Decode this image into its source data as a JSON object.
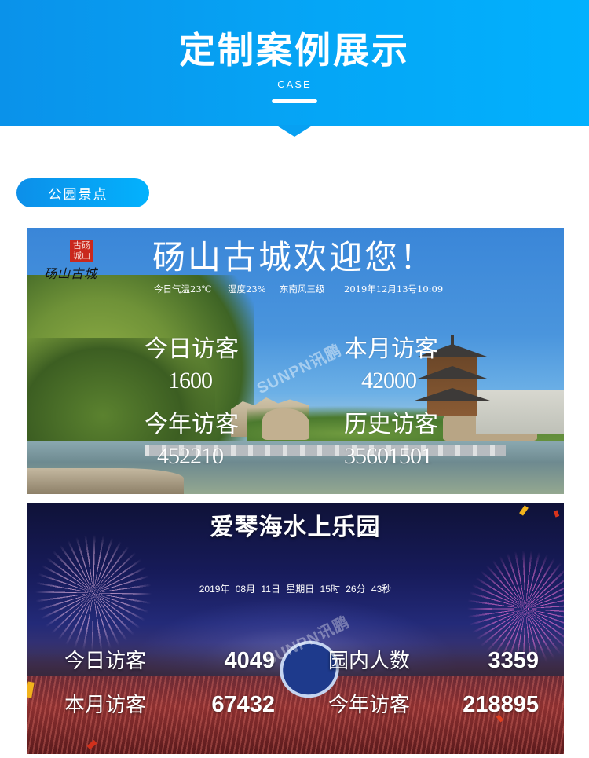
{
  "header": {
    "title": "定制案例展示",
    "subtitle": "CASE"
  },
  "category": {
    "label": "公园景点"
  },
  "screens": [
    {
      "name": "砀山古城",
      "seal_text": "古砀城山",
      "logo_text": "砀山古城",
      "title": "砀山古城欢迎您！",
      "info": {
        "temperature": "今日气温23℃",
        "humidity": "湿度23%",
        "wind": "东南风三级",
        "datetime": "2019年12月13号10:09"
      },
      "stats": [
        {
          "label": "今日访客",
          "value": "1600"
        },
        {
          "label": "本月访客",
          "value": "42000"
        },
        {
          "label": "今年访客",
          "value": "452210"
        },
        {
          "label": "历史访客",
          "value": "35601501"
        }
      ],
      "watermark": "SUNPN讯鹏"
    },
    {
      "name": "爱琴海水上乐园",
      "title": "爱琴海水上乐园",
      "datetime": "2019年 08月 11日 星期日 15时 26分 43秒",
      "stats": [
        {
          "label": "今日访客",
          "value": "4049"
        },
        {
          "label": "园内人数",
          "value": "3359"
        },
        {
          "label": "本月访客",
          "value": "67432"
        },
        {
          "label": "今年访客",
          "value": "218895"
        }
      ],
      "watermark": "SUNPN讯鹏"
    }
  ],
  "colors": {
    "brand_blue": "#07a0f2",
    "seal_red": "#c9281d"
  }
}
